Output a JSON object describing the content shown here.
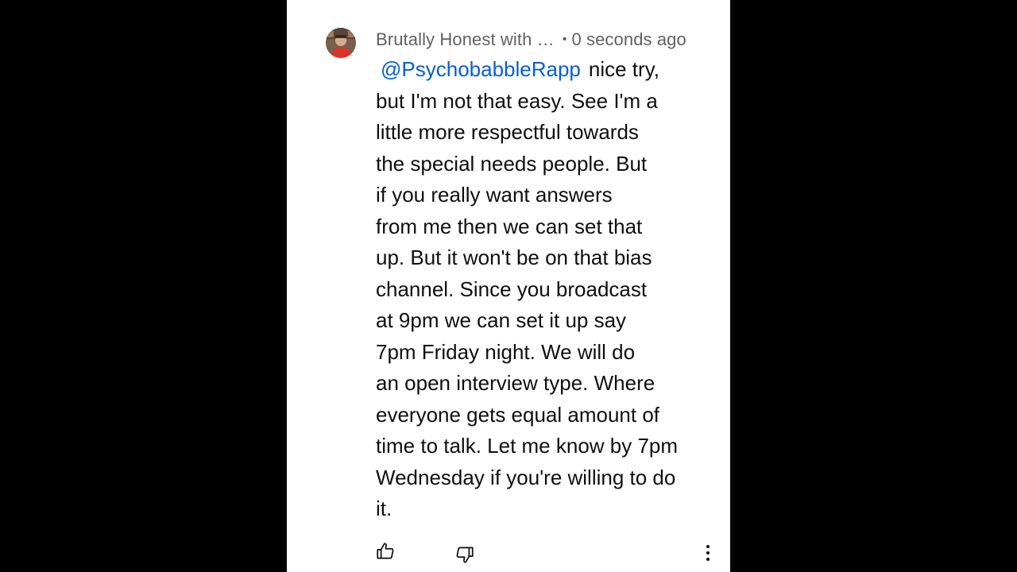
{
  "comment": {
    "author": "Brutally Honest with …",
    "separator": "•",
    "time": "0 seconds ago",
    "mention": "@PsychobabbleRapp",
    "lines": [
      "nice try,",
      "but I'm not that easy. See I'm a",
      "little more respectful towards",
      "the special needs people. But",
      "if you really want answers",
      "from me then we can set that",
      "up. But it won't be on that bias",
      "channel. Since you broadcast",
      "at 9pm we can set it up say",
      "7pm Friday night. We will do",
      "an open interview type. Where",
      "everyone gets equal amount of",
      "time to talk. Let me know by 7pm",
      "Wednesday if you're willing to do",
      "it."
    ]
  },
  "actions": {
    "like_icon": "thumbs-up-icon",
    "dislike_icon": "thumbs-down-icon",
    "more_icon": "more-vertical-icon"
  },
  "colors": {
    "background": "#000000",
    "panel": "#ffffff",
    "mention": "#065fd4",
    "meta_text": "#606060",
    "body_text": "#0f0f0f"
  }
}
